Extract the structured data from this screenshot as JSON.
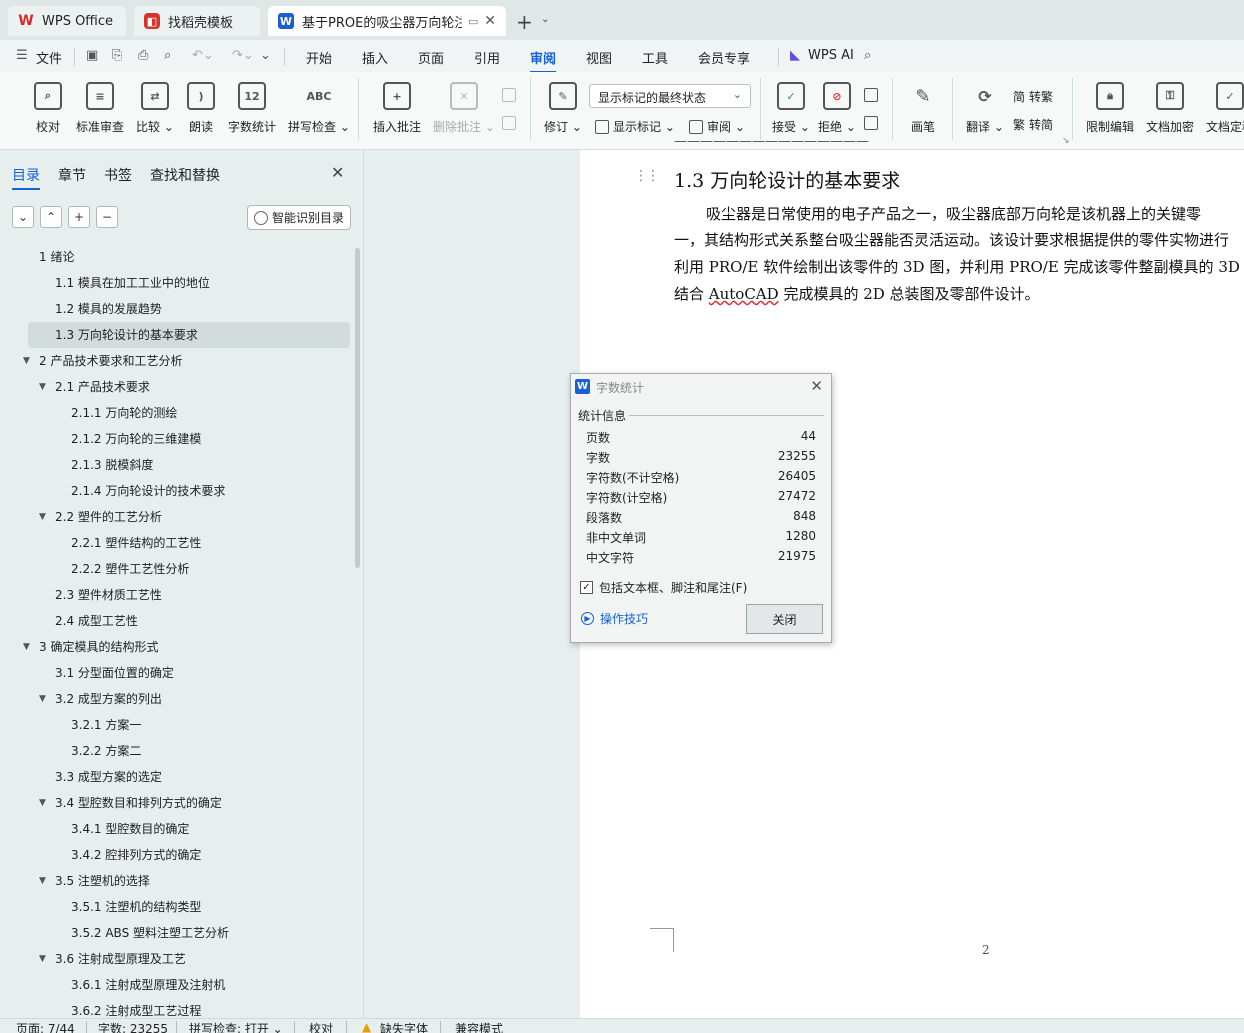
{
  "tabs": [
    {
      "label": "WPS Office",
      "icon": "wps-logo-icon"
    },
    {
      "label": "找稻壳模板",
      "icon": "docer-icon"
    },
    {
      "label": "基于PROE的吸尘器万向轮注射",
      "icon": "wps-writer-icon"
    }
  ],
  "menu": {
    "file": "文件",
    "items": [
      "开始",
      "插入",
      "页面",
      "引用",
      "审阅",
      "视图",
      "工具",
      "会员专享"
    ],
    "active": "审阅",
    "wps_ai": "WPS AI"
  },
  "ribbon": {
    "proofread": "校对",
    "standard_review": "标准审查",
    "compare": "比较",
    "read_aloud": "朗读",
    "word_count": "字数统计",
    "spell_check": "拼写检查",
    "insert_comment": "插入批注",
    "delete_comment": "删除批注",
    "revise": "修订",
    "markup_select": "显示标记的最终状态",
    "show_markup": "显示标记",
    "review_pane": "审阅",
    "accept": "接受",
    "reject": "拒绝",
    "pen": "画笔",
    "translate": "翻译",
    "to_traditional": "转繁",
    "to_simplified": "转简",
    "restrict_edit": "限制编辑",
    "encrypt": "文档加密",
    "finalize": "文档定稿"
  },
  "left_panel": {
    "tabs": [
      "目录",
      "章节",
      "书签",
      "查找和替换"
    ],
    "active_tab": "目录",
    "smart_toc": "智能识别目录",
    "toc": [
      {
        "text": "1  绪论",
        "level": 1,
        "arrow": ""
      },
      {
        "text": "1.1  模具在加工工业中的地位",
        "level": 2,
        "arrow": ""
      },
      {
        "text": "1.2  模具的发展趋势",
        "level": 2,
        "arrow": ""
      },
      {
        "text": "1.3  万向轮设计的基本要求",
        "level": 2,
        "arrow": "",
        "selected": true
      },
      {
        "text": "2  产品技术要求和工艺分析",
        "level": 1,
        "arrow": "▼"
      },
      {
        "text": "2.1  产品技术要求",
        "level": 2,
        "arrow": "▼"
      },
      {
        "text": "2.1.1  万向轮的测绘",
        "level": 3,
        "arrow": ""
      },
      {
        "text": "2.1.2  万向轮的三维建模",
        "level": 3,
        "arrow": ""
      },
      {
        "text": "2.1.3  脱模斜度",
        "level": 3,
        "arrow": ""
      },
      {
        "text": "2.1.4  万向轮设计的技术要求",
        "level": 3,
        "arrow": ""
      },
      {
        "text": "2.2  塑件的工艺分析",
        "level": 2,
        "arrow": "▼"
      },
      {
        "text": "2.2.1  塑件结构的工艺性",
        "level": 3,
        "arrow": ""
      },
      {
        "text": "2.2.2  塑件工艺性分析",
        "level": 3,
        "arrow": ""
      },
      {
        "text": "2.3  塑件材质工艺性",
        "level": 2,
        "arrow": ""
      },
      {
        "text": "2.4  成型工艺性",
        "level": 2,
        "arrow": ""
      },
      {
        "text": "3  确定模具的结构形式",
        "level": 1,
        "arrow": "▼"
      },
      {
        "text": "3.1  分型面位置的确定",
        "level": 2,
        "arrow": ""
      },
      {
        "text": "3.2  成型方案的列出",
        "level": 2,
        "arrow": "▼"
      },
      {
        "text": "3.2.1  方案一",
        "level": 3,
        "arrow": ""
      },
      {
        "text": "3.2.2  方案二",
        "level": 3,
        "arrow": ""
      },
      {
        "text": "3.3  成型方案的选定",
        "level": 2,
        "arrow": ""
      },
      {
        "text": "3.4  型腔数目和排列方式的确定",
        "level": 2,
        "arrow": "▼"
      },
      {
        "text": "3.4.1  型腔数目的确定",
        "level": 3,
        "arrow": ""
      },
      {
        "text": "3.4.2  腔排列方式的确定",
        "level": 3,
        "arrow": ""
      },
      {
        "text": "3.5  注塑机的选择",
        "level": 2,
        "arrow": "▼"
      },
      {
        "text": "3.5.1  注塑机的结构类型",
        "level": 3,
        "arrow": ""
      },
      {
        "text": "3.5.2 ABS 塑料注塑工艺分析",
        "level": 3,
        "arrow": ""
      },
      {
        "text": "3.6  注射成型原理及工艺",
        "level": 2,
        "arrow": "▼"
      },
      {
        "text": "3.6.1  注射成型原理及注射机",
        "level": 3,
        "arrow": ""
      },
      {
        "text": "3.6.2  注射成型工艺过程",
        "level": 3,
        "arrow": ""
      }
    ]
  },
  "document": {
    "heading": "1.3  万向轮设计的基本要求",
    "lines": [
      "吸尘器是日常使用的电子产品之一，吸尘器底部万向轮是该机器上的关键零",
      "一，其结构形式关系整台吸尘器能否灵活运动。该设计要求根据提供的零件实物进行",
      "利用 PRO/E 软件绘制出该零件的 3D 图，并利用 PRO/E 完成该零件整副模具的 3D",
      "结合 AutoCAD 完成模具的 2D 总装图及零部件设计。"
    ],
    "page_number": "2"
  },
  "dialog": {
    "title": "字数统计",
    "section": "统计信息",
    "stats": [
      {
        "label": "页数",
        "value": "44"
      },
      {
        "label": "字数",
        "value": "23255"
      },
      {
        "label": "字符数(不计空格)",
        "value": "26405"
      },
      {
        "label": "字符数(计空格)",
        "value": "27472"
      },
      {
        "label": "段落数",
        "value": "848"
      },
      {
        "label": "非中文单词",
        "value": "1280"
      },
      {
        "label": "中文字符",
        "value": "21975"
      }
    ],
    "checkbox_label": "包括文本框、脚注和尾注(F)",
    "checkbox_checked": true,
    "tips": "操作技巧",
    "close": "关闭"
  },
  "status": {
    "page": "页面: 7/44",
    "words": "字数: 23255",
    "spell": "拼写检查: 打开",
    "proof": "校对",
    "missing_font": "缺失字体",
    "compat": "兼容模式"
  }
}
